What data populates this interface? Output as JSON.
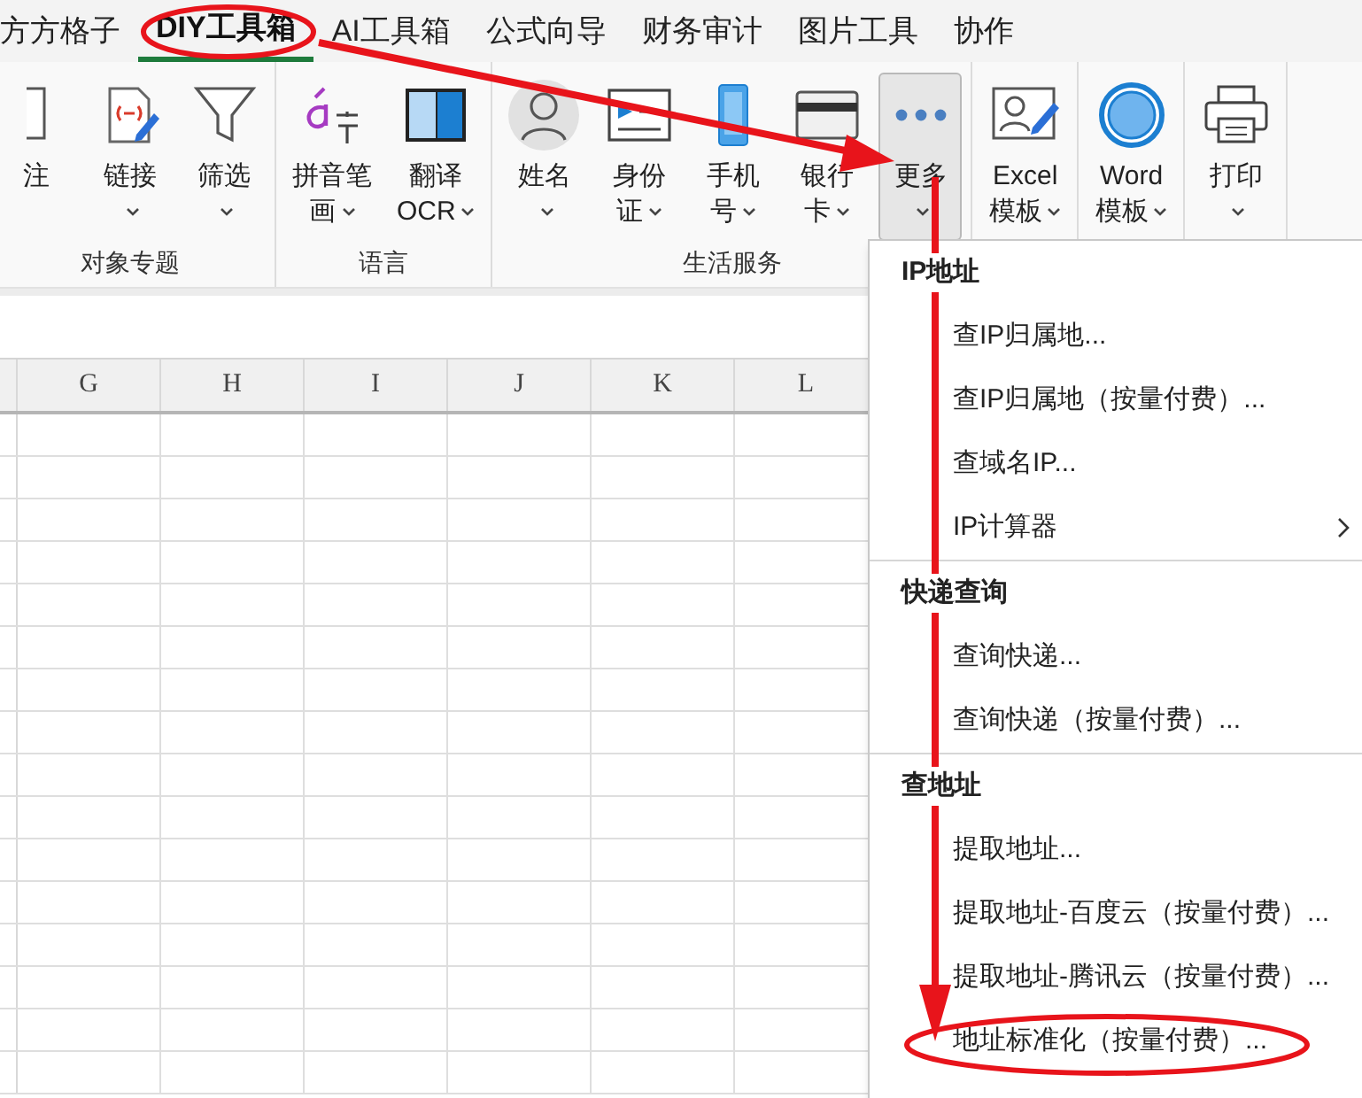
{
  "tabs": [
    {
      "label": "方方格子",
      "selected": false
    },
    {
      "label": "DIY工具箱",
      "selected": true
    },
    {
      "label": "AI工具箱",
      "selected": false
    },
    {
      "label": "公式向导",
      "selected": false
    },
    {
      "label": "财务审计",
      "selected": false
    },
    {
      "label": "图片工具",
      "selected": false
    },
    {
      "label": "协作",
      "selected": false
    }
  ],
  "ribbon_groups": [
    {
      "label": "对象专题",
      "buttons": [
        {
          "kind": "note",
          "lines": [
            "注"
          ],
          "dropdown": false,
          "selected": false
        },
        {
          "kind": "link",
          "lines": [
            "链接"
          ],
          "dropdown": true,
          "selected": false
        },
        {
          "kind": "filter",
          "lines": [
            "筛选"
          ],
          "dropdown": true,
          "selected": false
        }
      ]
    },
    {
      "label": "语言",
      "buttons": [
        {
          "kind": "pinyin",
          "lines": [
            "拼音笔",
            "画"
          ],
          "dropdown": true,
          "selected": false
        },
        {
          "kind": "translate",
          "lines": [
            "翻译",
            "OCR"
          ],
          "dropdown": true,
          "selected": false
        }
      ]
    },
    {
      "label": "生活服务",
      "buttons": [
        {
          "kind": "person",
          "lines": [
            "姓名"
          ],
          "dropdown": true,
          "selected": false
        },
        {
          "kind": "idcard",
          "lines": [
            "身份",
            "证"
          ],
          "dropdown": true,
          "selected": false
        },
        {
          "kind": "phone",
          "lines": [
            "手机",
            "号"
          ],
          "dropdown": true,
          "selected": false
        },
        {
          "kind": "bankcard",
          "lines": [
            "银行",
            "卡"
          ],
          "dropdown": true,
          "selected": false
        },
        {
          "kind": "more",
          "lines": [
            "更多"
          ],
          "dropdown": true,
          "selected": true
        }
      ]
    },
    {
      "buttons": [
        {
          "kind": "excel",
          "lines": [
            "Excel",
            "模板"
          ],
          "dropdown": true,
          "selected": false
        }
      ]
    },
    {
      "buttons": [
        {
          "kind": "word",
          "lines": [
            "Word",
            "模板"
          ],
          "dropdown": true,
          "selected": false
        }
      ]
    },
    {
      "buttons": [
        {
          "kind": "print",
          "lines": [
            "打印"
          ],
          "dropdown": true,
          "selected": false
        }
      ]
    }
  ],
  "columns": [
    "G",
    "H",
    "I",
    "J",
    "K",
    "L"
  ],
  "menu": {
    "sections": [
      {
        "header": "IP地址",
        "items": [
          {
            "label": "查IP归属地...",
            "submenu": false
          },
          {
            "label": "查IP归属地（按量付费）...",
            "submenu": false
          },
          {
            "label": "查域名IP...",
            "submenu": false
          },
          {
            "label": "IP计算器",
            "submenu": true
          }
        ]
      },
      {
        "header": "快递查询",
        "items": [
          {
            "label": "查询快递...",
            "submenu": false
          },
          {
            "label": "查询快递（按量付费）...",
            "submenu": false
          }
        ]
      },
      {
        "header": "查地址",
        "items": [
          {
            "label": "提取地址...",
            "submenu": false
          },
          {
            "label": "提取地址-百度云（按量付费）...",
            "submenu": false
          },
          {
            "label": "提取地址-腾讯云（按量付费）...",
            "submenu": false
          },
          {
            "label": "地址标准化（按量付费）...",
            "submenu": false
          }
        ]
      }
    ]
  }
}
